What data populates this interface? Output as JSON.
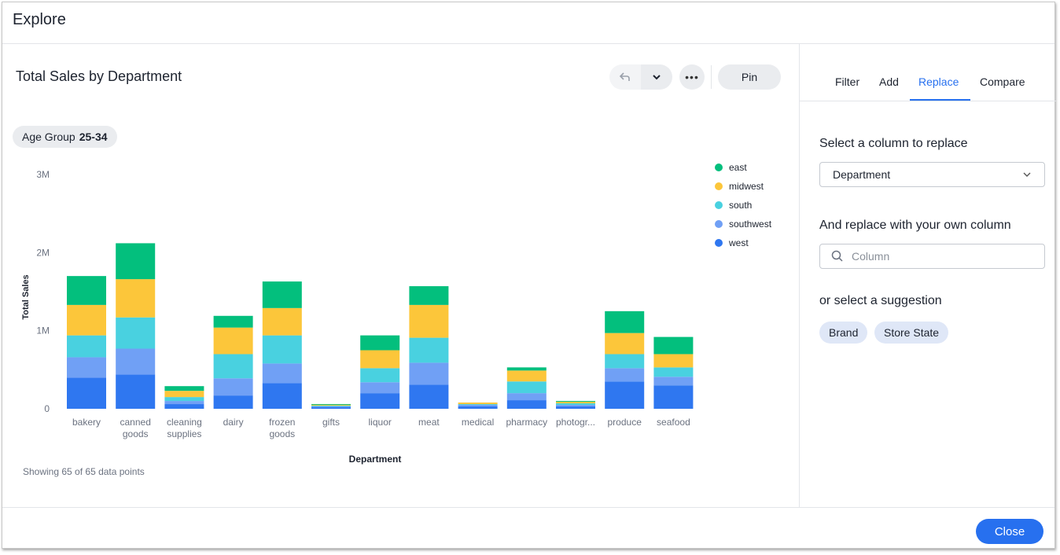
{
  "dialog": {
    "title": "Explore"
  },
  "chart_header": {
    "title": "Total Sales by Department"
  },
  "toolbar": {
    "undo_icon": "undo-icon",
    "dropdown_icon": "chevron-down-icon",
    "more_icon": "more-icon",
    "more_label": "•••",
    "pin_label": "Pin"
  },
  "filter_chip": {
    "label": "Age Group",
    "value": "25-34"
  },
  "footer_note": "Showing 65 of 65 data points",
  "side": {
    "tabs": [
      {
        "label": "Filter",
        "active": false
      },
      {
        "label": "Add",
        "active": false
      },
      {
        "label": "Replace",
        "active": true
      },
      {
        "label": "Compare",
        "active": false
      }
    ],
    "select_label": "Select a column to replace",
    "select_value": "Department",
    "replace_label": "And replace with your own column",
    "search_placeholder": "Column",
    "search_value": "",
    "suggest_label": "or select a suggestion",
    "suggestions": [
      "Brand",
      "Store State"
    ]
  },
  "footer": {
    "close_label": "Close"
  },
  "colors": {
    "accent": "#2770ef"
  },
  "chart_data": {
    "type": "bar",
    "stacked": true,
    "title": "Total Sales by Department",
    "xlabel": "Department",
    "ylabel": "Total Sales",
    "ylim": [
      0,
      3000000
    ],
    "yticks": [
      0,
      1000000,
      2000000,
      3000000
    ],
    "ytick_labels": [
      "0",
      "1M",
      "2M",
      "3M"
    ],
    "legend_position": "top-right",
    "categories": [
      "bakery",
      "canned goods",
      "cleaning supplies",
      "dairy",
      "frozen goods",
      "gifts",
      "liquor",
      "meat",
      "medical",
      "pharmacy",
      "photogr...",
      "produce",
      "seafood"
    ],
    "category_labels": [
      [
        "bakery"
      ],
      [
        "canned",
        "goods"
      ],
      [
        "cleaning",
        "supplies"
      ],
      [
        "dairy"
      ],
      [
        "frozen",
        "goods"
      ],
      [
        "gifts"
      ],
      [
        "liquor"
      ],
      [
        "meat"
      ],
      [
        "medical"
      ],
      [
        "pharmacy"
      ],
      [
        "photogr..."
      ],
      [
        "produce"
      ],
      [
        "seafood"
      ]
    ],
    "series": [
      {
        "name": "west",
        "color": "#2f77f0",
        "values": [
          400000,
          440000,
          60000,
          170000,
          330000,
          20000,
          200000,
          310000,
          30000,
          110000,
          30000,
          350000,
          300000
        ]
      },
      {
        "name": "southwest",
        "color": "#70a0f5",
        "values": [
          260000,
          330000,
          40000,
          220000,
          250000,
          10000,
          140000,
          280000,
          20000,
          90000,
          20000,
          170000,
          110000
        ]
      },
      {
        "name": "south",
        "color": "#49d1e0",
        "values": [
          280000,
          400000,
          50000,
          310000,
          360000,
          10000,
          180000,
          320000,
          10000,
          150000,
          20000,
          180000,
          120000
        ]
      },
      {
        "name": "midwest",
        "color": "#fcc63a",
        "values": [
          390000,
          490000,
          80000,
          340000,
          350000,
          10000,
          230000,
          420000,
          20000,
          140000,
          20000,
          270000,
          170000
        ]
      },
      {
        "name": "east",
        "color": "#03bf7d",
        "values": [
          370000,
          460000,
          60000,
          150000,
          340000,
          10000,
          190000,
          240000,
          0,
          40000,
          10000,
          280000,
          220000
        ]
      }
    ],
    "legend_order": [
      "east",
      "midwest",
      "south",
      "southwest",
      "west"
    ]
  }
}
